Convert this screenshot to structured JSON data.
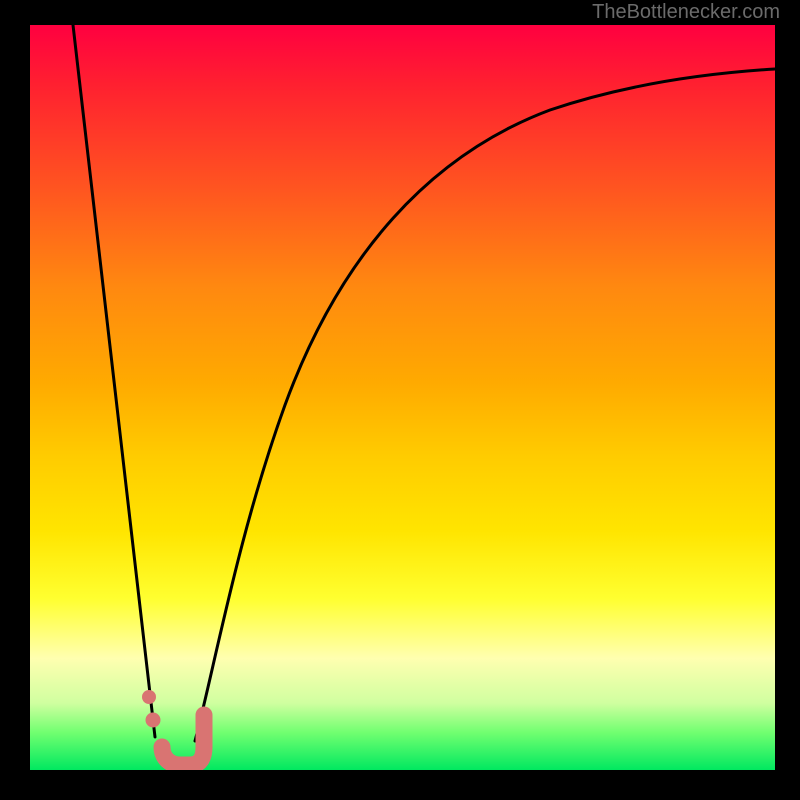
{
  "watermark": "TheBottlenecker.com",
  "chart_data": {
    "type": "line",
    "title": "",
    "xlabel": "",
    "ylabel": "",
    "xlim": [
      0,
      100
    ],
    "ylim": [
      0,
      100
    ],
    "background_gradient": {
      "direction": "top-to-bottom",
      "stops": [
        {
          "pos": 0,
          "color": "#ff0040"
        },
        {
          "pos": 50,
          "color": "#ffcc00"
        },
        {
          "pos": 80,
          "color": "#ffff80"
        },
        {
          "pos": 100,
          "color": "#00e860"
        }
      ]
    },
    "series": [
      {
        "name": "left-line",
        "x": [
          6,
          17
        ],
        "y": [
          100,
          4
        ],
        "style": "line",
        "color": "#000000"
      },
      {
        "name": "right-curve",
        "x": [
          22,
          26,
          30,
          35,
          40,
          50,
          60,
          70,
          80,
          90,
          100
        ],
        "y": [
          4,
          20,
          40,
          55,
          65,
          78,
          85,
          89,
          92,
          93,
          94
        ],
        "style": "line",
        "color": "#000000"
      }
    ],
    "markers": [
      {
        "name": "dot-upper",
        "x": 16,
        "y": 10,
        "color": "#d97472"
      },
      {
        "name": "dot-lower",
        "x": 16.5,
        "y": 7,
        "color": "#d97472"
      },
      {
        "name": "hook",
        "shape": "J",
        "x_range": [
          17.5,
          23.5
        ],
        "y_range": [
          0.5,
          7.5
        ],
        "color": "#d97472"
      }
    ],
    "annotations": [
      {
        "text": "TheBottlenecker.com",
        "position": "top-right",
        "color": "#6b6b6b"
      }
    ]
  }
}
